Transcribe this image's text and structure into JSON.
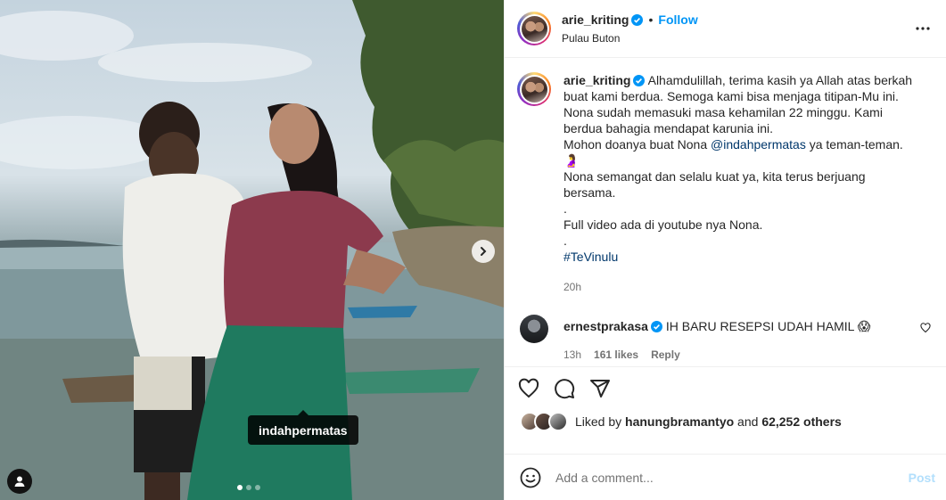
{
  "post": {
    "author": "arie_kriting",
    "follow_label": "Follow",
    "separator": "•",
    "location": "Pulau Buton",
    "photo_tag": "indahpermatas",
    "carousel": {
      "total": 3,
      "active": 0
    }
  },
  "caption": {
    "author": "arie_kriting",
    "line1": "Alhamdulillah, terima kasih ya Allah atas berkah buat kami berdua. Semoga kami bisa menjaga titipan-Mu ini.",
    "line2": "Nona sudah memasuki masa kehamilan 22 minggu. Kami berdua bahagia mendapat karunia ini.",
    "line3_pre": "Mohon doanya buat Nona ",
    "mention": "@indahpermatas",
    "line3_post": " ya teman-teman. 🤰",
    "line4": "Nona semangat dan selalu kuat ya, kita terus berjuang bersama.",
    "dot1": ".",
    "line5": "Full video ada di youtube nya Nona.",
    "dot2": ".",
    "hashtag": "#TeVinulu",
    "time": "20h"
  },
  "comments": [
    {
      "author": "ernestprakasa",
      "text": "IH BARU RESEPSI UDAH HAMIL 😱",
      "time": "13h",
      "likes": "161 likes",
      "reply_label": "Reply"
    }
  ],
  "likes": {
    "prefix": "Liked by ",
    "user": "hanungbramantyo",
    "middle": " and ",
    "others": "62,252 others"
  },
  "add_comment": {
    "placeholder": "Add a comment...",
    "post_label": "Post"
  },
  "colors": {
    "accent": "#0095f6",
    "text": "#262626",
    "secondary": "#737373",
    "link": "#00376b",
    "post_disabled": "#b2dffc"
  },
  "icons": [
    "verified-badge-icon",
    "more-options-icon",
    "chevron-right-icon",
    "user-tag-icon",
    "heart-icon",
    "comment-icon",
    "share-icon",
    "emoji-icon"
  ]
}
